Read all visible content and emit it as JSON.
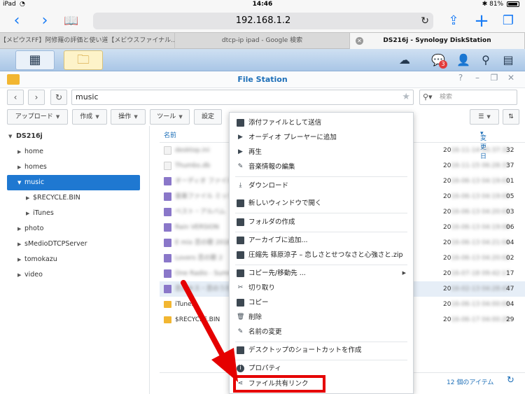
{
  "status": {
    "device": "iPad",
    "time": "14:46",
    "battery": "81%"
  },
  "safari": {
    "url": "192.168.1.2"
  },
  "tabs": [
    {
      "label": "【メビウスFF】阿修羅の評価と使い道【メビウスファイナル…"
    },
    {
      "label": "dtcp-ip ipad - Google 検索"
    },
    {
      "label": "DS216j - Synology DiskStation"
    }
  ],
  "dsm": {
    "notification_count": "3"
  },
  "window": {
    "title": "File Station"
  },
  "nav": {
    "path": "music",
    "search_placeholder": "検索"
  },
  "toolbar": {
    "upload": "アップロード",
    "create": "作成",
    "action": "操作",
    "tools": "ツール",
    "settings": "設定"
  },
  "tree": {
    "root": "DS216j",
    "items": [
      {
        "label": "home"
      },
      {
        "label": "homes"
      },
      {
        "label": "music"
      },
      {
        "label": "$RECYCLE.BIN"
      },
      {
        "label": "iTunes"
      },
      {
        "label": "photo"
      },
      {
        "label": "sMedioDTCPServer"
      },
      {
        "label": "tomokazu"
      },
      {
        "label": "video"
      }
    ]
  },
  "list": {
    "col_name": "名前",
    "col_modified": "変更日",
    "rows": [
      {
        "name": "desktop.ini",
        "date_prefix": "20",
        "date_rest": "16-11-14 05:37:32",
        "end": "32"
      },
      {
        "name": "Thumbs.db",
        "date_prefix": "20",
        "date_rest": "16-11-15 06:28:37",
        "end": "37"
      },
      {
        "name": "オーディオ ファイル",
        "date_prefix": "20",
        "date_rest": "16-06-13 04:19:01",
        "end": "01"
      },
      {
        "name": "音楽ファイル ミックス",
        "date_prefix": "20",
        "date_rest": "16-06-13 04:19:05",
        "end": "05"
      },
      {
        "name": "ベスト・アルバム",
        "date_prefix": "20",
        "date_rest": "16-06-13 04:20:03",
        "end": "03"
      },
      {
        "name": "Rain VERSION",
        "date_prefix": "20",
        "date_rest": "16-06-13 04:19:06",
        "end": "06"
      },
      {
        "name": "E mix 恋の歌 2016",
        "date_prefix": "20",
        "date_rest": "16-06-13 04:21:04",
        "end": "04"
      },
      {
        "name": "Lovers 恋の歌 2",
        "date_prefix": "20",
        "date_rest": "16-06-13 04:20:02",
        "end": "02"
      },
      {
        "name": "One Radio - Summer",
        "date_prefix": "20",
        "date_rest": "16-07-18 09:42:17",
        "end": "17"
      },
      {
        "name": "恋のキス・恋のうた",
        "date_prefix": "20",
        "date_rest": "16-02-13 04:28:47",
        "end": "47"
      },
      {
        "name": "iTunes",
        "date_prefix": "20",
        "date_rest": "16-06-13 04:00:04",
        "end": "04"
      },
      {
        "name": "$RECYCLE.BIN",
        "date_prefix": "20",
        "date_rest": "16-06-17 04:00:29",
        "end": "29"
      }
    ],
    "item_count": "12 個のアイテム"
  },
  "context_menu": {
    "items": [
      {
        "label": "添付ファイルとして送信",
        "icon": "mail-icon"
      },
      {
        "label": "オーディオ プレーヤーに追加",
        "icon": "play-icon"
      },
      {
        "label": "再生",
        "icon": "play-icon"
      },
      {
        "label": "音楽情報の編集",
        "icon": "pencil-icon"
      },
      {
        "label": "ダウンロード",
        "icon": "download-icon"
      },
      {
        "label": "新しいウィンドウで開く",
        "icon": "new-window-icon"
      },
      {
        "label": "フォルダの作成",
        "icon": "create-folder-icon"
      },
      {
        "label": "アーカイブに追加...",
        "icon": "archive-icon"
      },
      {
        "label": "圧縮先 篠原涼子 – 恋しさとせつなさと心強さと.zip",
        "icon": "archive-icon"
      },
      {
        "label": "コピー先/移動先 ...",
        "icon": "copy-move-icon"
      },
      {
        "label": "切り取り",
        "icon": "scissors-icon"
      },
      {
        "label": "コピー",
        "icon": "copy-icon"
      },
      {
        "label": "削除",
        "icon": "trash-icon"
      },
      {
        "label": "名前の変更",
        "icon": "rename-icon"
      },
      {
        "label": "デスクトップのショートカットを作成",
        "icon": "shortcut-icon"
      },
      {
        "label": "プロパティ",
        "icon": "info-icon"
      },
      {
        "label": "ファイル共有リンク",
        "icon": "share-icon"
      }
    ]
  },
  "annotation": {
    "highlight_color": "#e50000"
  }
}
